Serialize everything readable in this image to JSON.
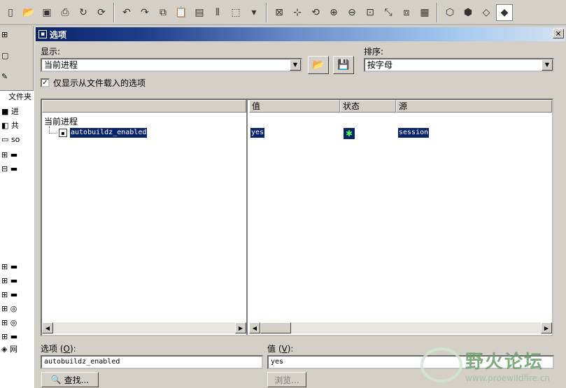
{
  "dialog": {
    "title": "选项",
    "close_glyph": "✕"
  },
  "display": {
    "label": "显示:",
    "value": "当前进程"
  },
  "sort": {
    "label": "排序:",
    "value": "按字母"
  },
  "filter": {
    "checked": true,
    "check_glyph": "✓",
    "label": "仅显示从文件载入的选项"
  },
  "list": {
    "columns": [
      "值",
      "状态",
      "源"
    ],
    "tree_root": "当前进程",
    "rows": [
      {
        "name": "autobuildz_enabled",
        "value": "yes",
        "status_glyph": "✱",
        "source": "session"
      }
    ]
  },
  "option_field": {
    "label_prefix": "选项 (",
    "hotkey": "O",
    "label_suffix": "):",
    "value": "autobuildz_enabled"
  },
  "value_field": {
    "label_prefix": "值 (",
    "hotkey": "V",
    "label_suffix": "):",
    "value": "yes"
  },
  "buttons": {
    "find": "查找...",
    "browse": "浏览..."
  },
  "left_panel": {
    "tab_label": "文件夹",
    "items": [
      "进",
      "共",
      "so",
      "网"
    ]
  },
  "watermark": {
    "title": "野火论坛",
    "url": "www.proewildfire.cn"
  }
}
